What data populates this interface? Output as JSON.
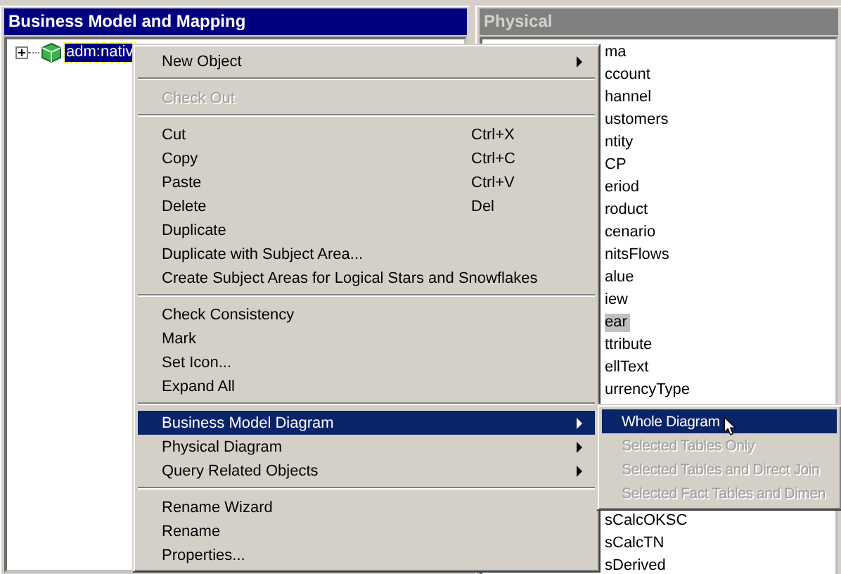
{
  "left_panel": {
    "title": "Business Model and Mapping",
    "tree": [
      {
        "label": "adm:nativ",
        "expanded": false,
        "selected": true
      }
    ]
  },
  "right_panel": {
    "title": "Physical",
    "items_above": [
      {
        "label": "ma",
        "selected": false
      },
      {
        "label": "ccount",
        "selected": false
      },
      {
        "label": "hannel",
        "selected": false
      },
      {
        "label": "ustomers",
        "selected": false
      },
      {
        "label": "ntity",
        "selected": false
      },
      {
        "label": "CP",
        "selected": false
      },
      {
        "label": "eriod",
        "selected": false
      },
      {
        "label": "roduct",
        "selected": false
      },
      {
        "label": "cenario",
        "selected": false
      },
      {
        "label": "nitsFlows",
        "selected": false
      },
      {
        "label": "alue",
        "selected": false
      },
      {
        "label": "iew",
        "selected": false
      },
      {
        "label": "ear",
        "selected": true
      },
      {
        "label": "ttribute",
        "selected": false
      },
      {
        "label": "ellText",
        "selected": false
      },
      {
        "label": "urrencyType",
        "selected": false
      }
    ],
    "items_below": [
      {
        "label": "sCalcOKSC",
        "selected": false
      },
      {
        "label": "sCalcTN",
        "selected": false
      },
      {
        "label": "sDerived",
        "selected": false
      }
    ]
  },
  "context_menu": {
    "groups": [
      [
        {
          "label": "New Object",
          "submenu": true,
          "disabled": false,
          "selected": false
        }
      ],
      [
        {
          "label": "Check Out",
          "disabled": true,
          "selected": false
        }
      ],
      [
        {
          "label": "Cut",
          "shortcut": "Ctrl+X",
          "disabled": false,
          "selected": false
        },
        {
          "label": "Copy",
          "shortcut": "Ctrl+C",
          "disabled": false,
          "selected": false
        },
        {
          "label": "Paste",
          "shortcut": "Ctrl+V",
          "disabled": false,
          "selected": false
        },
        {
          "label": "Delete",
          "shortcut": "Del",
          "disabled": false,
          "selected": false
        },
        {
          "label": "Duplicate",
          "disabled": false,
          "selected": false
        },
        {
          "label": "Duplicate with Subject Area...",
          "disabled": false,
          "selected": false
        },
        {
          "label": "Create Subject Areas for Logical Stars and Snowflakes",
          "disabled": false,
          "selected": false
        }
      ],
      [
        {
          "label": "Check Consistency",
          "disabled": false,
          "selected": false
        },
        {
          "label": "Mark",
          "disabled": false,
          "selected": false
        },
        {
          "label": "Set Icon...",
          "disabled": false,
          "selected": false
        },
        {
          "label": "Expand All",
          "disabled": false,
          "selected": false
        }
      ],
      [
        {
          "label": "Business Model Diagram",
          "submenu": true,
          "disabled": false,
          "selected": true
        },
        {
          "label": "Physical Diagram",
          "submenu": true,
          "disabled": false,
          "selected": false
        },
        {
          "label": "Query Related Objects",
          "submenu": true,
          "disabled": false,
          "selected": false
        }
      ],
      [
        {
          "label": "Rename Wizard",
          "disabled": false,
          "selected": false
        },
        {
          "label": "Rename",
          "disabled": false,
          "selected": false
        },
        {
          "label": "Properties...",
          "disabled": false,
          "selected": false
        }
      ]
    ]
  },
  "submenu": [
    {
      "label": "Whole Diagram",
      "disabled": false,
      "selected": true
    },
    {
      "label": "Selected Tables Only",
      "disabled": true,
      "selected": false
    },
    {
      "label": "Selected Tables and Direct Join",
      "disabled": true,
      "selected": false
    },
    {
      "label": "Selected Fact Tables and Dimen",
      "disabled": true,
      "selected": false
    }
  ]
}
